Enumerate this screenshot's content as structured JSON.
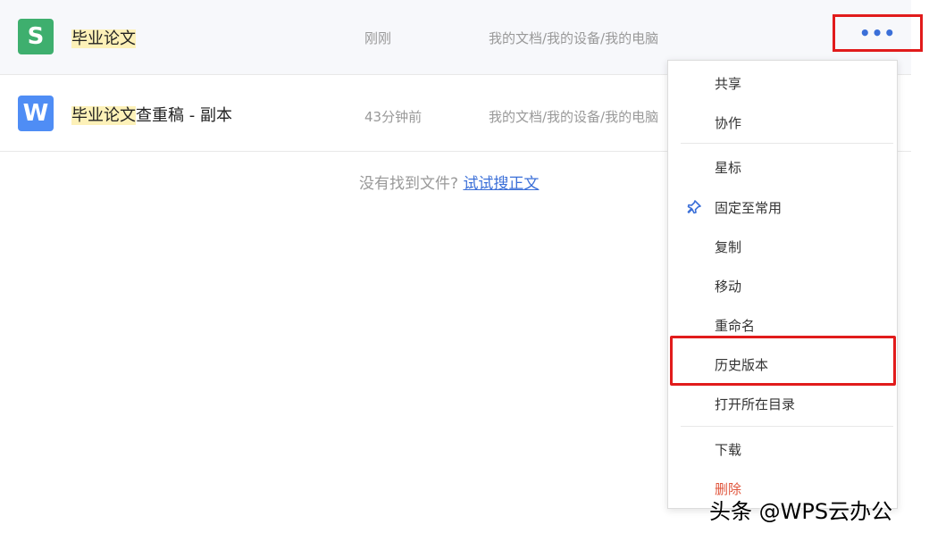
{
  "files": [
    {
      "icon_letter": "S",
      "icon": "wps-spreadsheet-icon",
      "name_highlight": "毕业论文",
      "name_rest": "",
      "time": "刚刚",
      "path": "我的文档/我的设备/我的电脑"
    },
    {
      "icon_letter": "W",
      "icon": "wps-writer-icon",
      "name_highlight": "毕业论文",
      "name_rest": "查重稿 - 副本",
      "time": "43分钟前",
      "path": "我的文档/我的设备/我的电脑"
    }
  ],
  "more_button": "•••",
  "hint": {
    "text": "没有找到文件?",
    "link": "试试搜正文"
  },
  "menu": {
    "share": "共享",
    "collaborate": "协作",
    "star": "星标",
    "pin": "固定至常用",
    "copy": "复制",
    "move": "移动",
    "rename": "重命名",
    "history": "历史版本",
    "open_folder": "打开所在目录",
    "download": "下载",
    "delete": "删除"
  },
  "watermark": "头条 @WPS云办公",
  "colors": {
    "accent": "#3b6fd8",
    "highlight": "#fdf1b8",
    "annotation": "#e11b1b",
    "danger": "#e0553c"
  }
}
